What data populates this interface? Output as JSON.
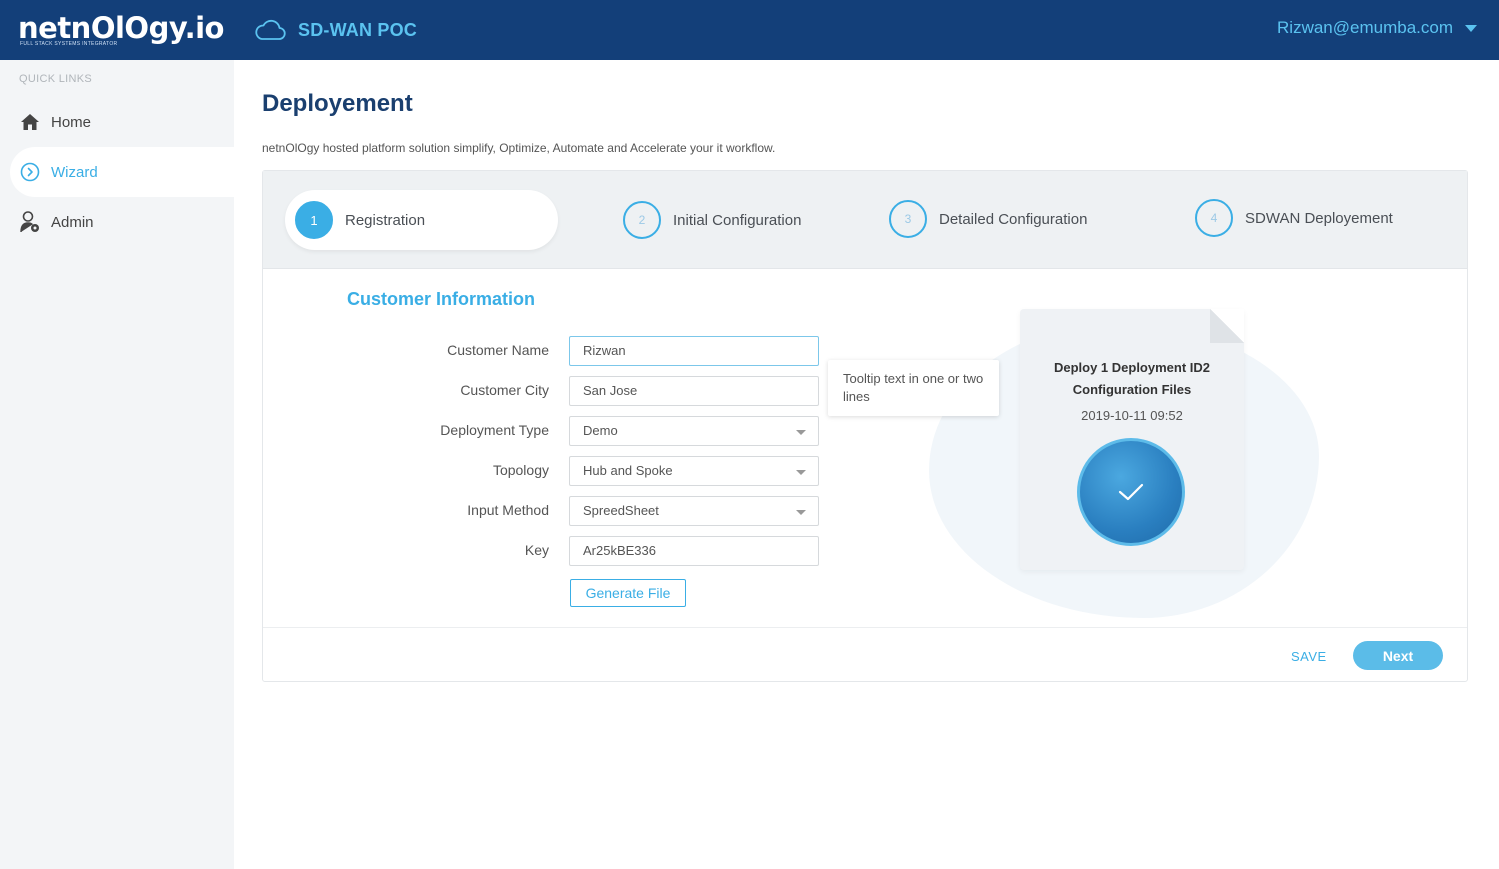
{
  "header": {
    "logo_text": "netnOlOgy.io",
    "logo_tagline": "FULL STACK SYSTEMS INTEGRATOR",
    "project_name": "SD-WAN POC",
    "project_icon": "cloud-icon",
    "user_email": "Rizwan@emumba.com",
    "accent_color": "#5bc3f0",
    "bar_color": "#133f79"
  },
  "sidebar": {
    "section_title": "QUICK LINKS",
    "items": [
      {
        "label": "Home",
        "icon": "home-icon",
        "active": false
      },
      {
        "label": "Wizard",
        "icon": "chevron-circle-icon",
        "active": true
      },
      {
        "label": "Admin",
        "icon": "admin-user-icon",
        "active": false
      }
    ]
  },
  "main": {
    "title": "Deployement",
    "subtitle": "netnOlOgy hosted platform solution simplify, Optimize, Automate and Accelerate your it workflow."
  },
  "steps": [
    {
      "number": "1",
      "label": "Registration",
      "active": true
    },
    {
      "number": "2",
      "label": "Initial Configuration",
      "active": false
    },
    {
      "number": "3",
      "label": "Detailed Configuration",
      "active": false
    },
    {
      "number": "4",
      "label": "SDWAN Deployement",
      "active": false
    }
  ],
  "form": {
    "section_title": "Customer Information",
    "fields": [
      {
        "label": "Customer Name",
        "value": "Rizwan",
        "type": "text"
      },
      {
        "label": "Customer City",
        "value": "San Jose",
        "type": "text"
      },
      {
        "label": "Deployment Type",
        "value": "Demo",
        "type": "select"
      },
      {
        "label": "Topology",
        "value": "Hub and Spoke",
        "type": "select"
      },
      {
        "label": "Input Method",
        "value": "SpreedSheet",
        "type": "select"
      },
      {
        "label": "Key",
        "value": "Ar25kBE336",
        "type": "text"
      }
    ],
    "generate_button": "Generate File",
    "tooltip": "Tooltip text in one or two lines"
  },
  "file_card": {
    "title_line1": "Deploy 1 Deployment ID2",
    "title_line2": "Configuration Files",
    "datetime": "2019-10-11  09:52",
    "status_icon": "check-icon"
  },
  "footer": {
    "save_label": "SAVE",
    "next_label": "Next"
  }
}
